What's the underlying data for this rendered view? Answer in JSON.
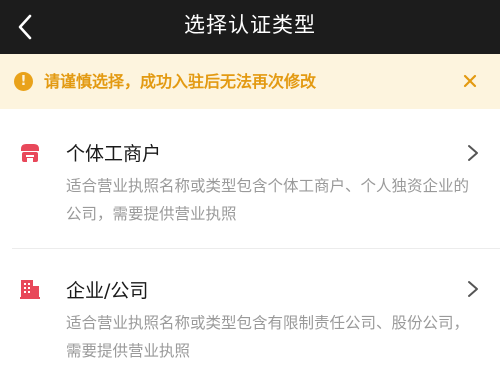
{
  "header": {
    "title": "选择认证类型",
    "back_icon": "chevron-left-icon"
  },
  "notice": {
    "text": "请谨慎选择，成功入驻后无法再次修改",
    "icon": "exclamation-icon",
    "icon_glyph": "!",
    "close_icon": "close-icon",
    "color": "#e39a12",
    "background": "#fdf4de"
  },
  "options": [
    {
      "title": "个体工商户",
      "description": "适合营业执照名称或类型包含个体工商户、个人独资企业的公司，需要提供营业执照",
      "icon": "storefront-icon"
    },
    {
      "title": "企业/公司",
      "description": "适合营业执照名称或类型包含有限制责任公司、股份公司，需要提供营业执照",
      "icon": "building-icon"
    }
  ],
  "colors": {
    "navbar": "#1c1c1c",
    "icon_accent": "#e8485a",
    "description": "#9a9a9a"
  }
}
